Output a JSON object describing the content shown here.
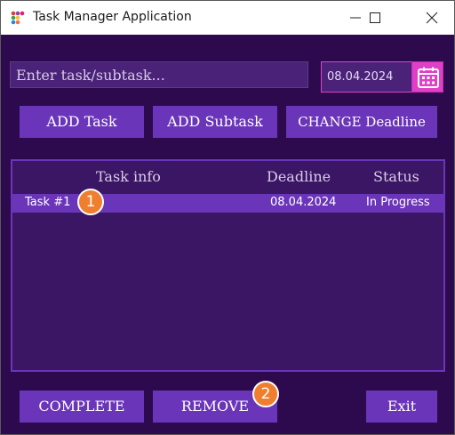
{
  "window": {
    "title": "Task Manager Application",
    "icon": "app-dots-icon"
  },
  "form": {
    "task_placeholder": "Enter task/subtask...",
    "date_value": "08.04.2024",
    "calendar_icon": "calendar-icon"
  },
  "toolbar": {
    "add_task_label": "ADD Task",
    "add_subtask_label": "ADD Subtask",
    "change_deadline_label": "CHANGE Deadline"
  },
  "table": {
    "headers": [
      "Task info",
      "Deadline",
      "Status"
    ],
    "rows": [
      {
        "name": "Task #1",
        "deadline": "08.04.2024",
        "status": "In Progress"
      }
    ]
  },
  "actions": {
    "complete_label": "COMPLETE",
    "remove_label": "REMOVE",
    "exit_label": "Exit"
  },
  "markers": [
    "1",
    "2"
  ],
  "colors": {
    "background": "#2d0a4e",
    "panel": "#3b1664",
    "button": "#6a35b8",
    "accent": "#e040c8",
    "marker": "#ef7f2f"
  }
}
